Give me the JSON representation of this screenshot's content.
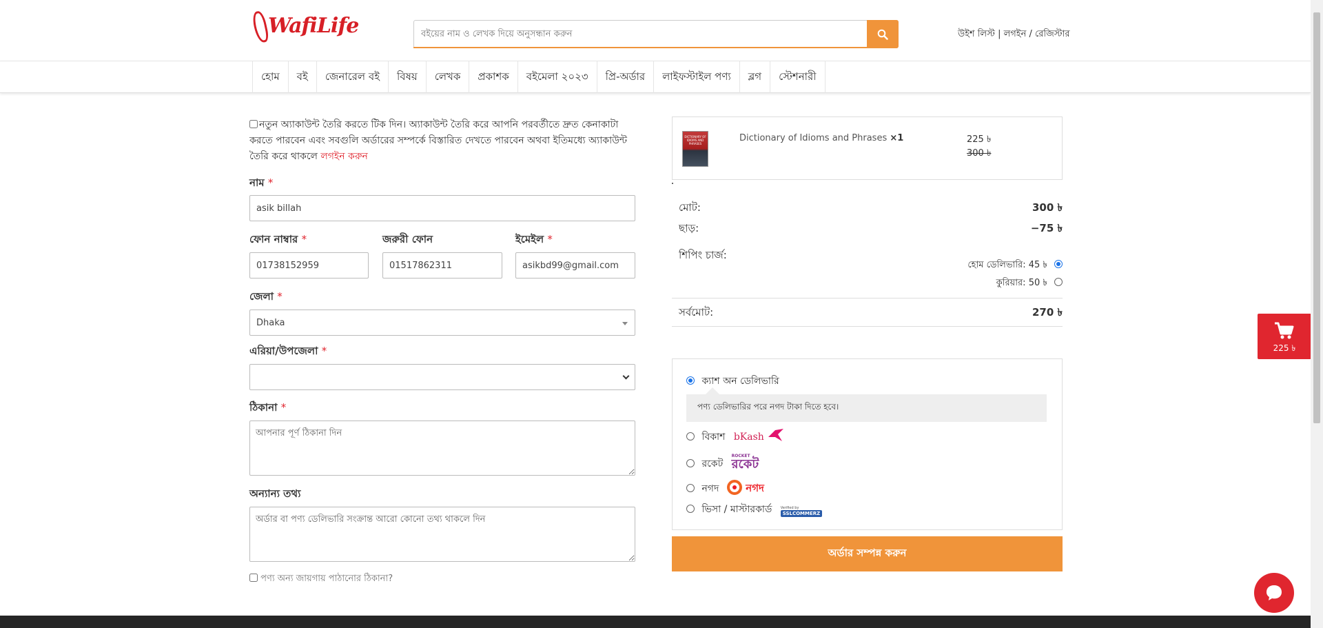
{
  "header": {
    "logo_text": "WafiLife",
    "search_placeholder": "বইয়ের নাম ও লেখক দিয়ে অনুসন্ধান করুন",
    "wishlist": "উইশ লিস্ট",
    "sep1": "|",
    "login": "লগইন",
    "sep2": "/",
    "register": "রেজিস্টার"
  },
  "nav": [
    "হোম",
    "বই",
    "জেনারেল বই",
    "বিষয়",
    "লেখক",
    "প্রকাশক",
    "বইমেলা ২০২৩",
    "প্রি-অর্ডার",
    "লাইফস্টাইল পণ্য",
    "ব্লগ",
    "স্টেশনারী"
  ],
  "form": {
    "create_account_text": "নতুন অ্যাকাউন্ট তৈরি করতে টিক দিন। অ্যাকাউন্ট তৈরি করে আপনি পরবর্তীতে দ্রুত কেনাকাটা করতে পারবেন এবং সবগুলি অর্ডারের সম্পর্কে বিস্তারিত দেখতে পারবেন অথবা ইতিমধ্যে অ্যাকাউন্ট তৈরি করে থাকলে",
    "login_link": "লগইন করুন",
    "name_label": "নাম",
    "name_value": "asik billah",
    "phone_label": "ফোন নাম্বার",
    "phone_value": "01738152959",
    "alt_phone_label": "জরুরী ফোন",
    "alt_phone_value": "01517862311",
    "email_label": "ইমেইল",
    "email_value": "asikbd99@gmail.com",
    "district_label": "জেলা",
    "district_value": "Dhaka",
    "area_label": "এরিয়া/উপজেলা",
    "area_value": "",
    "address_label": "ঠিকানা",
    "address_placeholder": "আপনার পূর্ণ ঠিকানা দিন",
    "other_label": "অন্যান্য তথ্য",
    "other_placeholder": "অর্ডার বা পণ্য ডেলিভারি সংক্রান্ত আরো কোনো তথ্য থাকলে দিন",
    "ship_other_text": "পণ্য অন্য জায়গায় পাঠানোর ঠিকানা?",
    "required_mark": "*"
  },
  "order": {
    "item_title": "Dictionary of Idioms and Phrases",
    "item_qty": "×1",
    "item_price": "225 ৳",
    "item_old_price": "300 ৳",
    "book_cover_text": "DICTIONARY OF IDIOMS AND PHRASES",
    "subtotal_label": "মোট:",
    "subtotal_value": "300 ৳",
    "discount_label": "ছাড়:",
    "discount_value": "−75 ৳",
    "shipping_label": "শিপিং চার্জ:",
    "home_delivery": "হোম ডেলিভারি: 45 ৳",
    "courier": "কুরিয়ার: 50 ৳",
    "total_label": "সর্বমোট:",
    "total_value": "270 ৳"
  },
  "payment": {
    "cod": "ক্যাশ অন ডেলিভারি",
    "cod_note": "পণ্য ডেলিভারির পরে নগদ টাকা দিতে হবে।",
    "bkash": "বিকাশ",
    "bkash_logo": "bKash",
    "rocket": "রকেট",
    "rocket_logo": "রকেট",
    "rocket_small": "ROCKET",
    "nagad": "নগদ",
    "nagad_logo": "নগদ",
    "card": "ভিসা / মাস্টারকার্ড",
    "ssl_top": "Verified by",
    "ssl_logo": "SSLCOMMERZ",
    "order_button": "অর্ডার সম্পন্ন করুন"
  },
  "cart": {
    "amount": "225 ৳"
  },
  "colors": {
    "brand_red": "#e0262f",
    "orange": "#f0943a"
  }
}
